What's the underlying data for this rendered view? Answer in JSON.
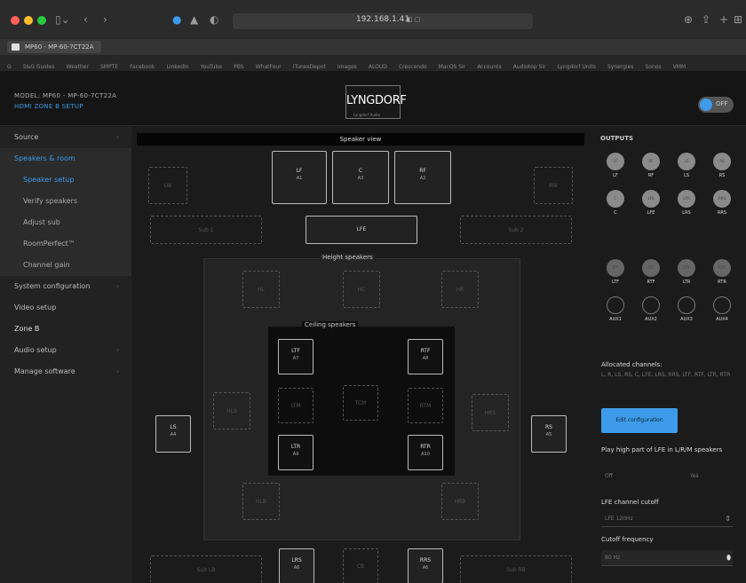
{
  "browser": {
    "url": "192.168.1.41",
    "tab_title": "MP60 - MP-60-7CT22A",
    "bookmarks": [
      "G",
      "S&G Guides",
      "Weather",
      "SMPTE",
      "Facebook",
      "LinkedIn",
      "YouTube",
      "PBS",
      "WhatFour",
      "iTunesDepot",
      "Images",
      "ALOUD",
      "Crescendo",
      "MacOS Sir",
      "Accounts",
      "Audiotop Sir",
      "Lyngdorf Units",
      "Synergies",
      "Sonos",
      "VMM"
    ]
  },
  "header": {
    "model": "MODEL: MP60 - MP-60-7CT22A",
    "breadcrumb": "HDMI ZONE B SETUP",
    "logo": "LYNGDORF",
    "logo_sub": "Lyngdorf Audio",
    "toggle_label": "OFF"
  },
  "sidebar": {
    "items": [
      {
        "label": "Source"
      },
      {
        "label": "Speakers & room"
      },
      {
        "label": "Speaker setup"
      },
      {
        "label": "Verify speakers"
      },
      {
        "label": "Adjust sub"
      },
      {
        "label": "RoomPerfect™"
      },
      {
        "label": "Channel gain"
      },
      {
        "label": "System configuration"
      },
      {
        "label": "Video setup"
      },
      {
        "label": "Zone B"
      },
      {
        "label": "Audio setup"
      },
      {
        "label": "Manage software"
      }
    ]
  },
  "speaker_view": {
    "title": "Speaker view",
    "height_label": "Height speakers",
    "ceiling_label": "Ceiling speakers",
    "speakers": {
      "lf": {
        "name": "LF",
        "channel": "A1"
      },
      "c": {
        "name": "C",
        "channel": "A3"
      },
      "rf": {
        "name": "RF",
        "channel": "A2"
      },
      "lw": {
        "name": "LW"
      },
      "rw": {
        "name": "RW"
      },
      "sub1": {
        "name": "Sub 1"
      },
      "lfe": {
        "name": "LFE"
      },
      "sub2": {
        "name": "Sub 2"
      },
      "hl": {
        "name": "HL"
      },
      "hc": {
        "name": "HC"
      },
      "hr": {
        "name": "HR"
      },
      "ltf": {
        "name": "LTF",
        "channel": "A7"
      },
      "rtf": {
        "name": "RTF",
        "channel": "A8"
      },
      "ltm": {
        "name": "LTM"
      },
      "tcm": {
        "name": "TCM"
      },
      "rtm": {
        "name": "RTM"
      },
      "ltr": {
        "name": "LTR",
        "channel": "A9"
      },
      "rtr": {
        "name": "RTR",
        "channel": "A10"
      },
      "ls": {
        "name": "LS",
        "channel": "A4"
      },
      "rs": {
        "name": "RS",
        "channel": "A5"
      },
      "hls": {
        "name": "HLS"
      },
      "hrs": {
        "name": "HRS"
      },
      "hlb": {
        "name": "HLB"
      },
      "hrb": {
        "name": "HRB"
      },
      "sub_lb": {
        "name": "Sub LB"
      },
      "lrs": {
        "name": "LRS",
        "channel": "A6"
      },
      "cb": {
        "name": "CB"
      },
      "rrs": {
        "name": "RRS",
        "channel": "A6"
      },
      "sub_rb": {
        "name": "Sub RB"
      }
    }
  },
  "outputs": {
    "title": "OUTPUTS",
    "row1": [
      {
        "label": "LF",
        "code": "LF"
      },
      {
        "label": "RF",
        "code": "RF"
      },
      {
        "label": "LS",
        "code": "LS"
      },
      {
        "label": "RS",
        "code": "RS"
      }
    ],
    "row2": [
      {
        "label": "C",
        "code": "C"
      },
      {
        "label": "LFE",
        "code": "LFE"
      },
      {
        "label": "LRS",
        "code": "LRS"
      },
      {
        "label": "RRS",
        "code": "RRS"
      }
    ],
    "row3": [
      {
        "label": "LTF",
        "code": "LTF"
      },
      {
        "label": "RTF",
        "code": "RTF"
      },
      {
        "label": "LTR",
        "code": "LTR"
      },
      {
        "label": "RTR",
        "code": "RTR"
      }
    ],
    "row4": [
      {
        "label": "AUX1"
      },
      {
        "label": "AUX2"
      },
      {
        "label": "AUX3"
      },
      {
        "label": "AUX4"
      }
    ]
  },
  "settings": {
    "allocated_title": "Allocated channels:",
    "allocated_list": "L, R, LS, RS, C, LFE, LRS, RRS, LTF, RTF, LTR, RTR",
    "edit_button": "Edit configuration",
    "play_high_title": "Play high part of LFE in L/R/M speakers",
    "toggle_off": "Off",
    "toggle_on": "Yes",
    "lfe_cutoff_title": "LFE channel cutoff",
    "lfe_cutoff_value": "LFE 120Hz",
    "cutoff_freq_title": "Cutoff frequency",
    "cutoff_freq_value": "80 Hz"
  }
}
